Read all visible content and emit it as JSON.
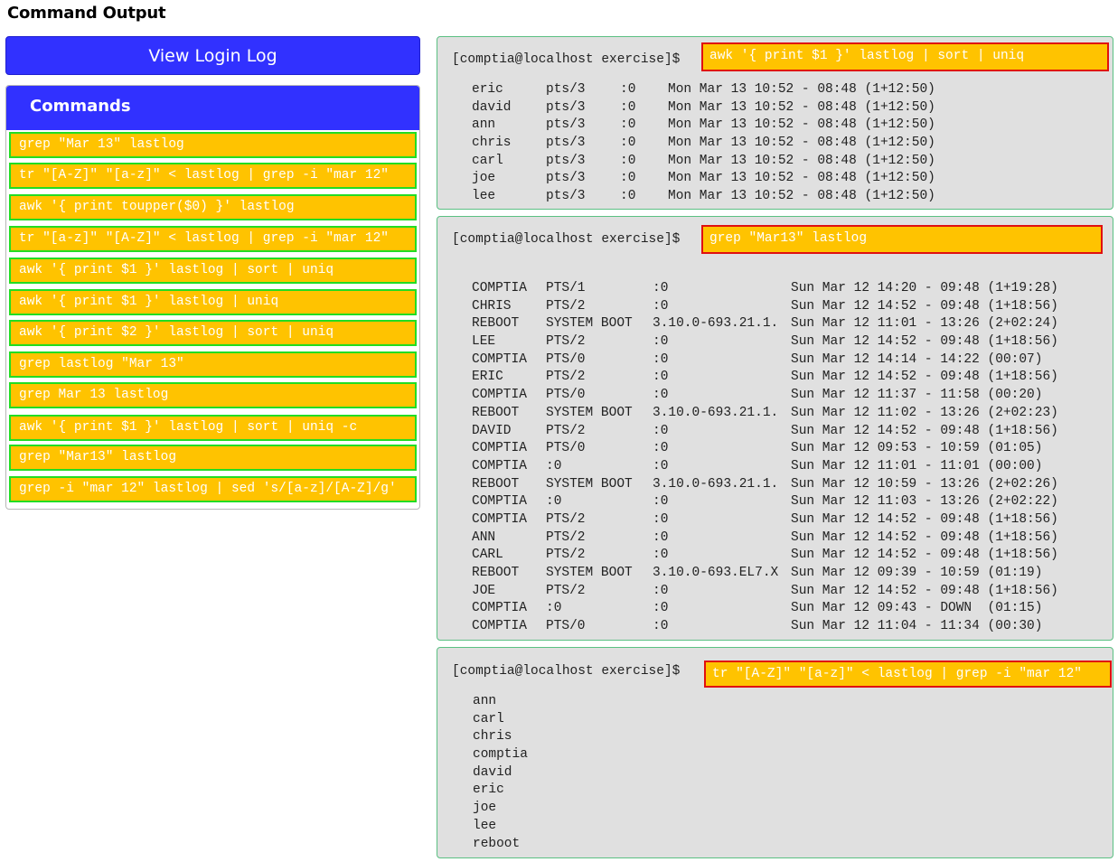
{
  "page_title": "Command Output",
  "view_login_log_label": "View Login Log",
  "commands": {
    "title": "Commands",
    "items": [
      "grep \"Mar 13\" lastlog",
      "tr \"[A-Z]\" \"[a-z]\" < lastlog | grep -i \"mar 12\"",
      "awk '{ print toupper($0) }' lastlog",
      "tr \"[a-z]\" \"[A-Z]\" < lastlog | grep -i \"mar 12\"",
      "awk '{ print $1 }' lastlog | sort | uniq",
      "awk '{ print $1 }' lastlog | uniq",
      "awk '{ print $2 }' lastlog | sort | uniq",
      "grep lastlog \"Mar 13\"",
      "grep Mar 13 lastlog",
      "awk '{ print $1 }' lastlog | sort | uniq -c",
      "grep \"Mar13\" lastlog",
      "grep -i \"mar 12\" lastlog | sed 's/[a-z]/[A-Z]/g'"
    ]
  },
  "terminals": [
    {
      "prompt": "[comptia@localhost exercise]$",
      "command": "awk '{ print $1 }' lastlog | sort | uniq",
      "rows": [
        [
          "eric",
          "pts/3",
          ":0",
          "Mon Mar 13 10:52 - 08:48 (1+12:50)"
        ],
        [
          "david",
          "pts/3",
          ":0",
          "Mon Mar 13 10:52 - 08:48 (1+12:50)"
        ],
        [
          "ann",
          "pts/3",
          ":0",
          "Mon Mar 13 10:52 - 08:48 (1+12:50)"
        ],
        [
          "chris",
          "pts/3",
          ":0",
          "Mon Mar 13 10:52 - 08:48 (1+12:50)"
        ],
        [
          "carl",
          "pts/3",
          ":0",
          "Mon Mar 13 10:52 - 08:48 (1+12:50)"
        ],
        [
          "joe",
          "pts/3",
          ":0",
          "Mon Mar 13 10:52 - 08:48 (1+12:50)"
        ],
        [
          "lee",
          "pts/3",
          ":0",
          "Mon Mar 13 10:52 - 08:48 (1+12:50)"
        ]
      ]
    },
    {
      "prompt": "[comptia@localhost exercise]$",
      "command": "grep \"Mar13\" lastlog",
      "rows": [
        [
          "COMPTIA",
          "PTS/1",
          ":0",
          "Sun Mar 12 14:20 - 09:48 (1+19:28)"
        ],
        [
          "CHRIS",
          "PTS/2",
          ":0",
          "Sun Mar 12 14:52 - 09:48 (1+18:56)"
        ],
        [
          "REBOOT",
          "SYSTEM BOOT",
          "3.10.0-693.21.1.",
          "Sun Mar 12 11:01 - 13:26 (2+02:24)"
        ],
        [
          "LEE",
          "PTS/2",
          ":0",
          "Sun Mar 12 14:52 - 09:48 (1+18:56)"
        ],
        [
          "COMPTIA",
          "PTS/0",
          ":0",
          "Sun Mar 12 14:14 - 14:22 (00:07)"
        ],
        [
          "ERIC",
          "PTS/2",
          ":0",
          "Sun Mar 12 14:52 - 09:48 (1+18:56)"
        ],
        [
          "COMPTIA",
          "PTS/0",
          ":0",
          "Sun Mar 12 11:37 - 11:58 (00:20)"
        ],
        [
          "REBOOT",
          "SYSTEM BOOT",
          "3.10.0-693.21.1.",
          "Sun Mar 12 11:02 - 13:26 (2+02:23)"
        ],
        [
          "DAVID",
          "PTS/2",
          ":0",
          "Sun Mar 12 14:52 - 09:48 (1+18:56)"
        ],
        [
          "COMPTIA",
          "PTS/0",
          ":0",
          "Sun Mar 12 09:53 - 10:59 (01:05)"
        ],
        [
          "COMPTIA",
          ":0",
          ":0",
          "Sun Mar 12 11:01 - 11:01 (00:00)"
        ],
        [
          "REBOOT",
          "SYSTEM BOOT",
          "3.10.0-693.21.1.",
          "Sun Mar 12 10:59 - 13:26 (2+02:26)"
        ],
        [
          "COMPTIA",
          ":0",
          ":0",
          "Sun Mar 12 11:03 - 13:26 (2+02:22)"
        ],
        [
          "COMPTIA",
          "PTS/2",
          ":0",
          "Sun Mar 12 14:52 - 09:48 (1+18:56)"
        ],
        [
          "ANN",
          "PTS/2",
          ":0",
          "Sun Mar 12 14:52 - 09:48 (1+18:56)"
        ],
        [
          "CARL",
          "PTS/2",
          ":0",
          "Sun Mar 12 14:52 - 09:48 (1+18:56)"
        ],
        [
          "REBOOT",
          "SYSTEM BOOT",
          "3.10.0-693.EL7.X",
          "Sun Mar 12 09:39 - 10:59 (01:19)"
        ],
        [
          "JOE",
          "PTS/2",
          ":0",
          "Sun Mar 12 14:52 - 09:48 (1+18:56)"
        ],
        [
          "COMPTIA",
          ":0",
          ":0",
          "Sun Mar 12 09:43 - DOWN  (01:15)"
        ],
        [
          "COMPTIA",
          "PTS/0",
          ":0",
          "Sun Mar 12 11:04 - 11:34 (00:30)"
        ]
      ]
    },
    {
      "prompt": "[comptia@localhost exercise]$",
      "command": "tr \"[A-Z]\" \"[a-z]\" < lastlog | grep -i \"mar 12\"",
      "rows": [
        [
          "ann"
        ],
        [
          "carl"
        ],
        [
          "chris"
        ],
        [
          "comptia"
        ],
        [
          "david"
        ],
        [
          "eric"
        ],
        [
          "joe"
        ],
        [
          "lee"
        ],
        [
          "reboot"
        ]
      ]
    }
  ]
}
